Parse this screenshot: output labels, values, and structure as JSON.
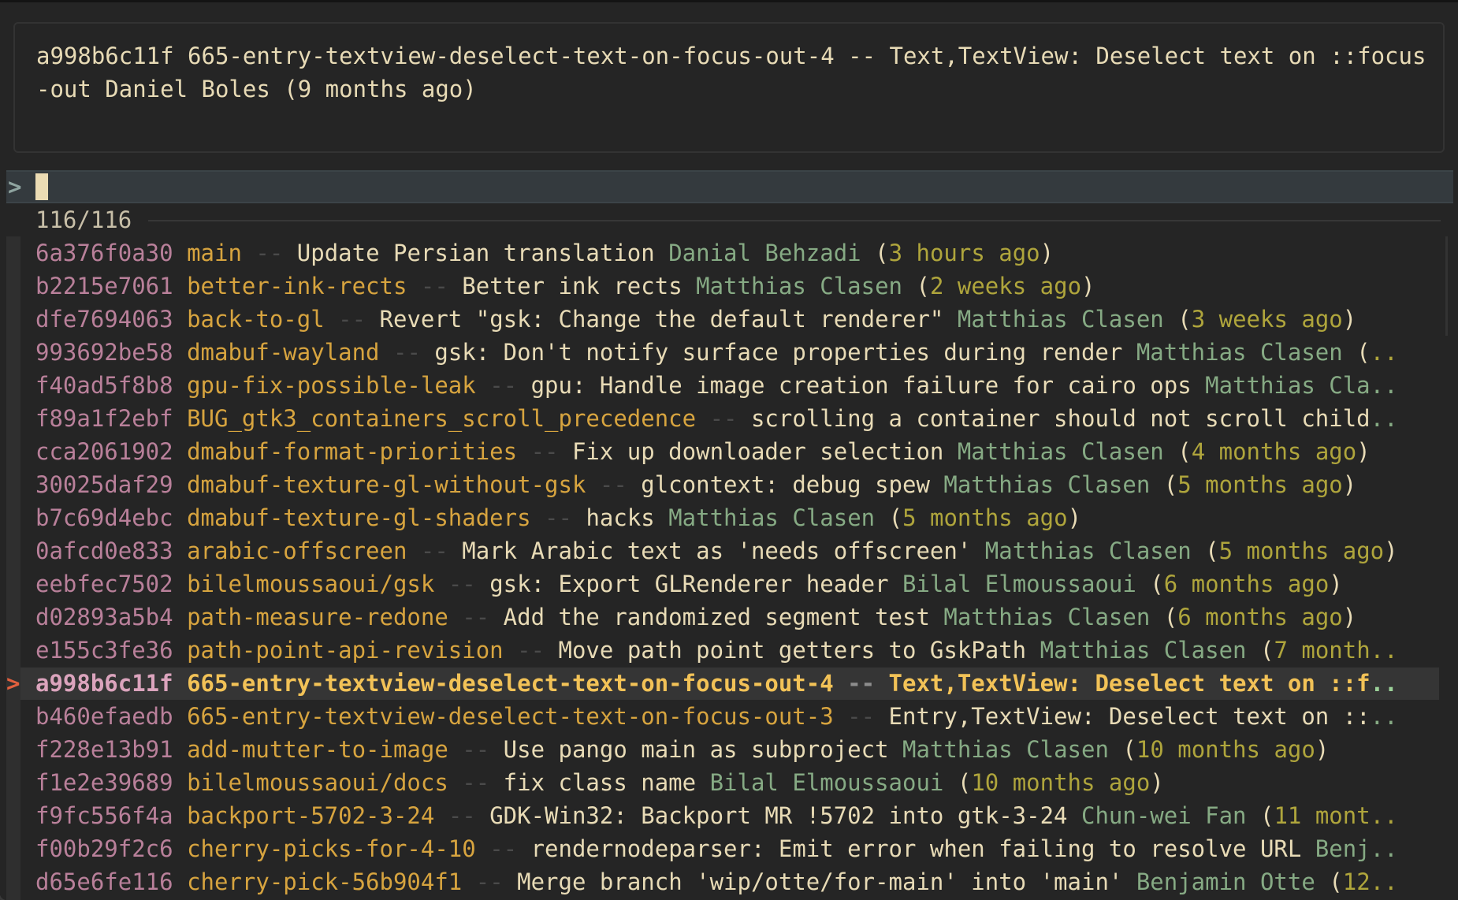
{
  "preview": {
    "text": "a998b6c11f 665-entry-textview-deselect-text-on-focus-out-4 -- Text,TextView: Deselect text on ::focus-out Daniel Boles (9 months ago)"
  },
  "prompt": {
    "symbol": ">",
    "query": ""
  },
  "info": {
    "match_count": "116/116"
  },
  "pointer_symbol": ">",
  "separator": "--",
  "ellipsis": "..",
  "rows": [
    {
      "hash": "6a376f0a30",
      "branch": "main",
      "message": "Update Persian translation",
      "author": "Danial Behzadi",
      "date": "3 hours ago",
      "truncated": "none",
      "current": false
    },
    {
      "hash": "b2215e7061",
      "branch": "better-ink-rects",
      "message": "Better ink rects",
      "author": "Matthias Clasen",
      "date": "2 weeks ago",
      "truncated": "none",
      "current": false
    },
    {
      "hash": "dfe7694063",
      "branch": "back-to-gl",
      "message": "Revert \"gsk: Change the default renderer\"",
      "author": "Matthias Clasen",
      "date": "3 weeks ago",
      "truncated": "none",
      "current": false
    },
    {
      "hash": "993692be58",
      "branch": "dmabuf-wayland",
      "message": "gsk: Don't notify surface properties during render",
      "author": "Matthias Clasen",
      "date": "",
      "truncated": "date",
      "current": false
    },
    {
      "hash": "f40ad5f8b8",
      "branch": "gpu-fix-possible-leak",
      "message": "gpu: Handle image creation failure for cairo ops",
      "author": "Matthias Cla",
      "date": "",
      "truncated": "author",
      "current": false
    },
    {
      "hash": "f89a1f2ebf",
      "branch": "BUG_gtk3_containers_scroll_precedence",
      "message": "scrolling a container should not scroll child",
      "author": "",
      "date": "",
      "truncated": "message",
      "current": false
    },
    {
      "hash": "cca2061902",
      "branch": "dmabuf-format-priorities",
      "message": "Fix up downloader selection",
      "author": "Matthias Clasen",
      "date": "4 months ago",
      "truncated": "none",
      "current": false
    },
    {
      "hash": "30025daf29",
      "branch": "dmabuf-texture-gl-without-gsk",
      "message": "glcontext: debug spew",
      "author": "Matthias Clasen",
      "date": "5 months ago",
      "truncated": "none",
      "current": false
    },
    {
      "hash": "b7c69d4ebc",
      "branch": "dmabuf-texture-gl-shaders",
      "message": "hacks",
      "author": "Matthias Clasen",
      "date": "5 months ago",
      "truncated": "none",
      "current": false
    },
    {
      "hash": "0afcd0e833",
      "branch": "arabic-offscreen",
      "message": "Mark Arabic text as 'needs offscreen'",
      "author": "Matthias Clasen",
      "date": "5 months ago",
      "truncated": "none",
      "current": false
    },
    {
      "hash": "eebfec7502",
      "branch": "bilelmoussaoui/gsk",
      "message": "gsk: Export GLRenderer header",
      "author": "Bilal Elmoussaoui",
      "date": "6 months ago",
      "truncated": "none",
      "current": false
    },
    {
      "hash": "d02893a5b4",
      "branch": "path-measure-redone",
      "message": "Add the randomized segment test",
      "author": "Matthias Clasen",
      "date": "6 months ago",
      "truncated": "none",
      "current": false
    },
    {
      "hash": "e155c3fe36",
      "branch": "path-point-api-revision",
      "message": "Move path point getters to GskPath",
      "author": "Matthias Clasen",
      "date": "7 month",
      "truncated": "date",
      "current": false
    },
    {
      "hash": "a998b6c11f",
      "branch": "665-entry-textview-deselect-text-on-focus-out-4",
      "message": "Text,TextView: Deselect text on ::f",
      "author": "",
      "date": "",
      "truncated": "message",
      "current": true
    },
    {
      "hash": "b460efaedb",
      "branch": "665-entry-textview-deselect-text-on-focus-out-3",
      "message": "Entry,TextView: Deselect text on ::",
      "author": "",
      "date": "",
      "truncated": "message",
      "current": false
    },
    {
      "hash": "f228e13b91",
      "branch": "add-mutter-to-image",
      "message": "Use pango main as subproject",
      "author": "Matthias Clasen",
      "date": "10 months ago",
      "truncated": "none",
      "current": false
    },
    {
      "hash": "f1e2e39689",
      "branch": "bilelmoussaoui/docs",
      "message": "fix class name",
      "author": "Bilal Elmoussaoui",
      "date": "10 months ago",
      "truncated": "none",
      "current": false
    },
    {
      "hash": "f9fc556f4a",
      "branch": "backport-5702-3-24",
      "message": "GDK-Win32: Backport MR !5702 into gtk-3-24",
      "author": "Chun-wei Fan",
      "date": "11 mont",
      "truncated": "date",
      "current": false
    },
    {
      "hash": "f00b29f2c6",
      "branch": "cherry-picks-for-4-10",
      "message": "rendernodeparser: Emit error when failing to resolve URL",
      "author": "Benj",
      "date": "",
      "truncated": "author",
      "current": false
    },
    {
      "hash": "d65e6fe116",
      "branch": "cherry-pick-56b904f1",
      "message": "Merge branch 'wip/otte/for-main' into 'main'",
      "author": "Benjamin Otte",
      "date": "12",
      "truncated": "date",
      "current": false
    }
  ],
  "colors": {
    "background": "#252525",
    "hash": "#b9809a",
    "branch": "#d7a43f",
    "message": "#e8dbb6",
    "author": "#86aa84",
    "date": "#afa53c",
    "pointer": "#e2603e",
    "highlight_text": "#f2c257",
    "prompt_bar": "#343a3e"
  }
}
